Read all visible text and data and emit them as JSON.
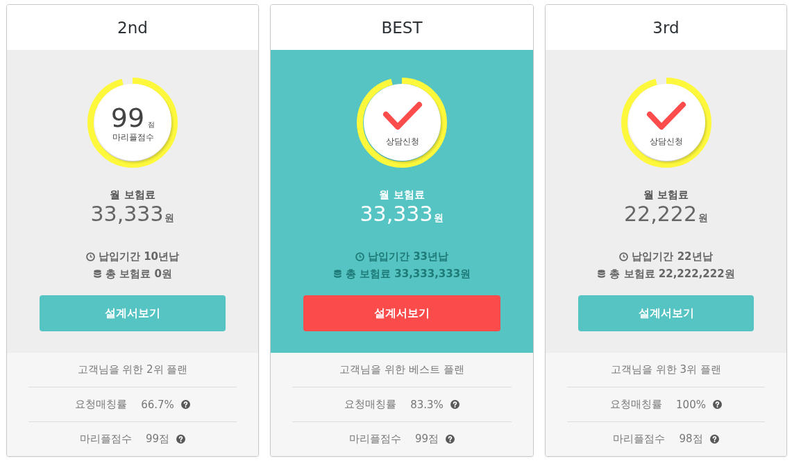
{
  "cards": [
    {
      "title": "2nd",
      "selected": false,
      "ring": {
        "level": 0.96
      },
      "badge": {
        "kind": "score",
        "value": "99",
        "unit": "점",
        "label": "마리플점수"
      },
      "premium": {
        "label": "월 보험료",
        "amount": "33,333",
        "unit": "원"
      },
      "details": [
        {
          "kind": "period",
          "text": "납입기간 10년납"
        },
        {
          "kind": "total",
          "text": "총 보험료 0원"
        }
      ],
      "button": "설계서보기",
      "plan_note": "고객님을 위한 2위 플랜",
      "stats": [
        {
          "label": "요청매칭률",
          "value": "66.7%"
        },
        {
          "label": "마리플점수",
          "value": "99점"
        }
      ]
    },
    {
      "title": "BEST",
      "selected": true,
      "ring": {
        "level": 0.96
      },
      "badge": {
        "kind": "check",
        "label": "상담신청"
      },
      "premium": {
        "label": "월 보험료",
        "amount": "33,333",
        "unit": "원"
      },
      "details": [
        {
          "kind": "period",
          "text": "납입기간 33년납"
        },
        {
          "kind": "total",
          "text": "총 보험료 33,333,333원"
        }
      ],
      "button": "설계서보기",
      "plan_note": "고객님을 위한 베스트 플랜",
      "stats": [
        {
          "label": "요청매칭률",
          "value": "83.3%"
        },
        {
          "label": "마리플점수",
          "value": "99점"
        }
      ]
    },
    {
      "title": "3rd",
      "selected": false,
      "ring": {
        "level": 0.96
      },
      "badge": {
        "kind": "check",
        "label": "상담신청"
      },
      "premium": {
        "label": "월 보험료",
        "amount": "22,222",
        "unit": "원"
      },
      "details": [
        {
          "kind": "period",
          "text": "납입기간 22년납"
        },
        {
          "kind": "total",
          "text": "총 보험료 22,222,222원"
        }
      ],
      "button": "설계서보기",
      "plan_note": "고객님을 위한 3위 플랜",
      "stats": [
        {
          "label": "요청매칭률",
          "value": "100%"
        },
        {
          "label": "마리플점수",
          "value": "98점"
        }
      ]
    }
  ]
}
